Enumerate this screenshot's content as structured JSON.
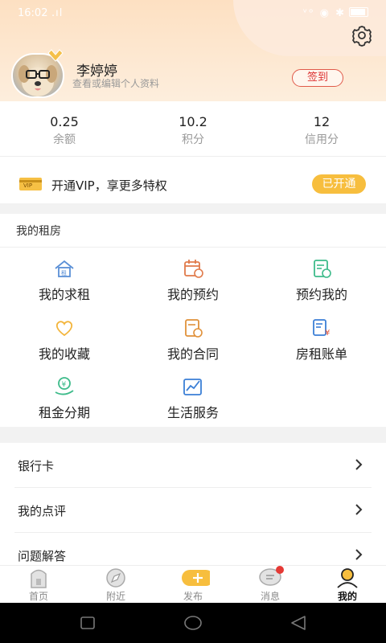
{
  "status": {
    "time": "16:02",
    "signal": ".ıl",
    "right": "ᵛᵒ ◉ ✱"
  },
  "profile": {
    "name": "李婷婷",
    "subtitle": "查看或编辑个人资料",
    "checkin_label": "签到"
  },
  "stats": [
    {
      "value": "0.25",
      "label": "余额"
    },
    {
      "value": "10.2",
      "label": "积分"
    },
    {
      "value": "12",
      "label": "信用分"
    }
  ],
  "vip": {
    "text": "开通VIP，享更多特权",
    "button": "已开通",
    "card_text": "VIP"
  },
  "rent": {
    "title": "我的租房",
    "items": [
      {
        "label": "我的求租",
        "icon": "house-icon"
      },
      {
        "label": "我的预约",
        "icon": "calendar-icon"
      },
      {
        "label": "预约我的",
        "icon": "schedule-icon"
      },
      {
        "label": "我的收藏",
        "icon": "heart-icon"
      },
      {
        "label": "我的合同",
        "icon": "contract-icon"
      },
      {
        "label": "房租账单",
        "icon": "bill-icon"
      },
      {
        "label": "租金分期",
        "icon": "installment-icon"
      },
      {
        "label": "生活服务",
        "icon": "chart-icon"
      }
    ]
  },
  "list": [
    {
      "label": "银行卡"
    },
    {
      "label": "我的点评"
    },
    {
      "label": "问题解答"
    }
  ],
  "tabs": [
    {
      "label": "首页",
      "icon": "home-icon"
    },
    {
      "label": "附近",
      "icon": "compass-icon"
    },
    {
      "label": "发布",
      "icon": "plus-icon"
    },
    {
      "label": "消息",
      "icon": "message-icon"
    },
    {
      "label": "我的",
      "icon": "profile-icon"
    }
  ],
  "colors": {
    "accent": "#f7be3e",
    "checkin": "#e05a4a",
    "header": "#fde0c2"
  }
}
